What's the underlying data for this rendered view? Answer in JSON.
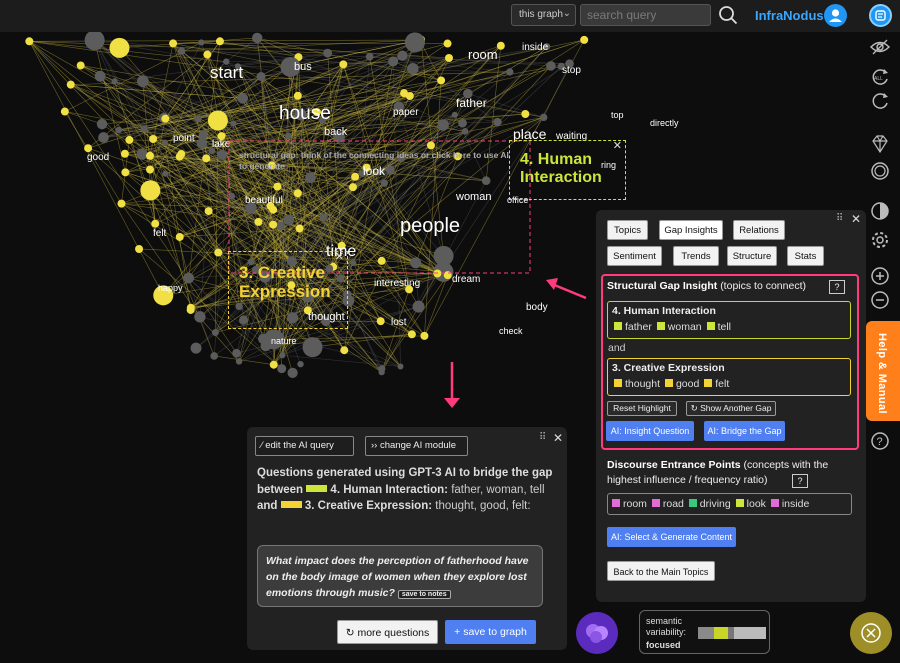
{
  "topbar": {
    "scope_value": "this graph",
    "search_placeholder": "search query",
    "brand": "InfraNodus"
  },
  "graph": {
    "node_labels": [
      "start",
      "bus",
      "room",
      "inside",
      "stop",
      "house",
      "paper",
      "father",
      "top",
      "directly",
      "back",
      "place",
      "waiting",
      "point",
      "lake",
      "good",
      "ring",
      "look",
      "woman",
      "office",
      "beautiful",
      "people",
      "felt",
      "time",
      "happy",
      "interesting",
      "dream",
      "body",
      "thought",
      "lost",
      "check",
      "nature"
    ]
  },
  "gaps": {
    "human": {
      "title": "4. Human Interaction"
    },
    "creative": {
      "title": "3. Creative Expression"
    },
    "hint": "structural gap: think of the connecting ideas or click here to use AI to generate"
  },
  "panel": {
    "tabs": [
      "Topics",
      "Gap Insights",
      "Relations",
      "Sentiment",
      "Trends",
      "Structure",
      "Stats"
    ],
    "insight_title": "Structural Gap Insight",
    "insight_sub": "(topics to connect)",
    "topic_a": {
      "title": "4. Human Interaction",
      "words": [
        "father",
        "woman",
        "tell"
      ],
      "color": "#cde53a"
    },
    "and_label": "and",
    "topic_b": {
      "title": "3. Creative Expression",
      "words": [
        "thought",
        "good",
        "felt"
      ],
      "color": "#f3d236"
    },
    "reset_label": "Reset Highlight",
    "another_gap_label": "Show Another Gap",
    "ai_question_label": "AI: Insight Question",
    "ai_bridge_label": "AI: Bridge the Gap",
    "discourse_title": "Discourse Entrance Points",
    "discourse_sub": "(concepts with the highest influence / frequency ratio)",
    "entrance_points": [
      {
        "word": "room",
        "color": "#e36bd6"
      },
      {
        "word": "road",
        "color": "#e36bd6"
      },
      {
        "word": "driving",
        "color": "#39c77d"
      },
      {
        "word": "look",
        "color": "#cde53a"
      },
      {
        "word": "inside",
        "color": "#e36bd6"
      }
    ],
    "select_generate_label": "AI: Select & Generate Content",
    "back_label": "Back to the Main Topics",
    "help": "?"
  },
  "ai_panel": {
    "edit_label": "edit the AI query",
    "module_label": "change AI module",
    "intro": "Questions generated using GPT-3 AI to bridge the gap between",
    "topic_a": "4. Human Interaction:",
    "topic_a_words": "father, woman, tell",
    "and": "and",
    "topic_b": "3. Creative Expression:",
    "topic_b_words": "thought, good, felt:",
    "question": "What impact does the perception of fatherhood have on the body image of women when they explore lost emotions through music?",
    "save_notes": "save to notes",
    "more_label": "more questions",
    "save_graph_label": "+ save to graph"
  },
  "help_tab": "Help & Manual",
  "semantic": {
    "label": "semantic variability:",
    "value": "focused"
  }
}
